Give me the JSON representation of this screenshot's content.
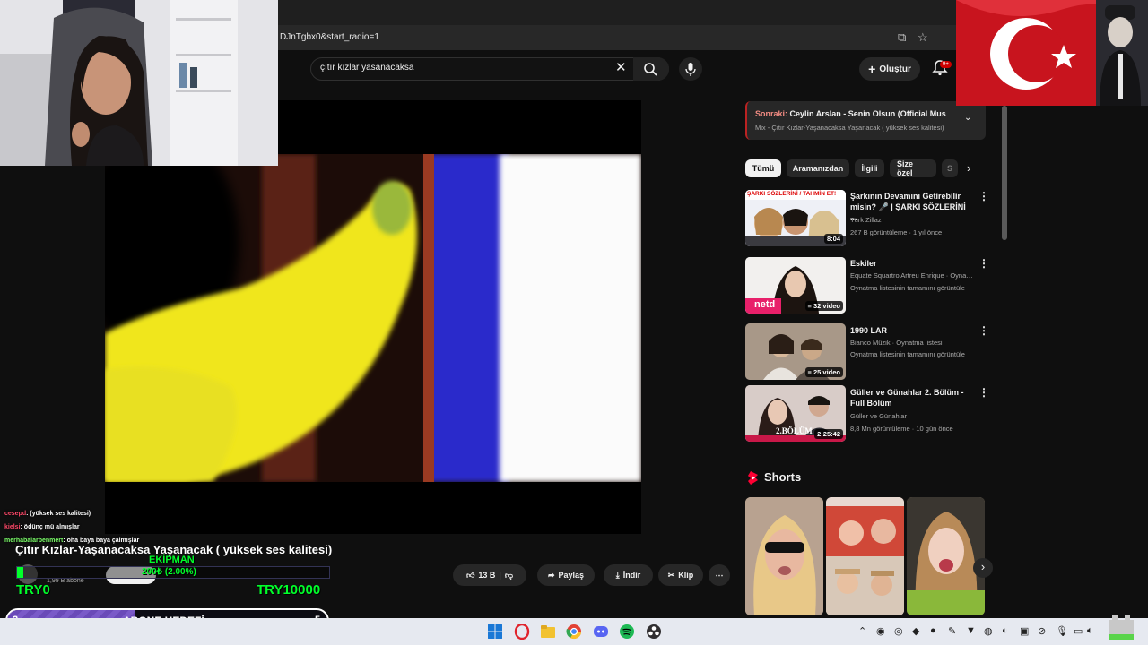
{
  "browser": {
    "url_fragment": "DJnTgbx0&start_radio=1"
  },
  "header": {
    "search_value": "çıtır kızlar yasanacaksa",
    "create_label": "Oluştur",
    "notif_badge": "9+"
  },
  "video": {
    "title": "Çıtır Kızlar-Yaşanacaksa Yaşanacak ( yüksek ses kalitesi)",
    "subs": "1,99 B abone",
    "like_count": "13 B",
    "share_label": "Paylaş",
    "download_label": "İndir",
    "clip_label": "Klip",
    "more_label": "⋯"
  },
  "playlist": {
    "next_prefix": "Sonraki:",
    "next_title": "Ceylin Arslan - Senin Olsun (Official Music ...",
    "mix_text": "Mix - Çıtır Kızlar-Yaşanacaksa Yaşanacak ( yüksek ses kalitesi)"
  },
  "chips": [
    {
      "label": "Tümü"
    },
    {
      "label": "Aramanızdan"
    },
    {
      "label": "İlgili"
    },
    {
      "label": "Size özel"
    },
    {
      "label": "S"
    }
  ],
  "recommendations": [
    {
      "title": "Şarkının Devamını Getirebilir misin? 🎤 | ŞARKI SÖZLERİNİ ...",
      "channel": "Türk Zillaz",
      "meta": "267 B görüntüleme · 1 yıl önce",
      "badge": "8:04",
      "thumb_text": "ŞARKI SÖZLERİNİ / TAHMİN ET!"
    },
    {
      "title": "Eskiler",
      "channel": "Equate Squartro Artreu Enrique · Oynatm...",
      "meta": "Oynatma listesinin tamamını görüntüle",
      "badge": "32 video",
      "thumb_text": "netd"
    },
    {
      "title": "1990 LAR",
      "channel": "Bianco Müzik · Oynatma listesi",
      "meta": "Oynatma listesinin tamamını görüntüle",
      "badge": "25 video",
      "thumb_text": ""
    },
    {
      "title": "Güller ve Günahlar 2. Bölüm - Full Bölüm",
      "channel": "Güller ve Günahlar",
      "meta": "8,8 Mn görüntüleme · 10 gün önce",
      "badge": "2:25:42",
      "thumb_text": "2.BÖLÜM"
    }
  ],
  "shorts": {
    "heading": "Shorts"
  },
  "overlay": {
    "chat": [
      {
        "user": "cesepd",
        "text": ": (yüksek ses kalitesi)"
      },
      {
        "user": "kielsi",
        "text": ": ödünç mü almışlar"
      },
      {
        "user": "merhabalarbenmert",
        "text": ": oha baya baya çalmışlar"
      }
    ],
    "goal": {
      "name": "EKİPMAN",
      "progress_text": "200₺ (2.00%)",
      "progress": 0.02,
      "min_label": "TRY0",
      "max_label": "TRY10000"
    },
    "sub_goal": {
      "current": "2",
      "label": "ABONE HEDEFİ",
      "target": "5",
      "progress": 0.4
    }
  },
  "colors": {
    "accent_red": "#cc0000",
    "goal_green": "#00ff2a",
    "sub_purple": "#7a5ac8"
  }
}
